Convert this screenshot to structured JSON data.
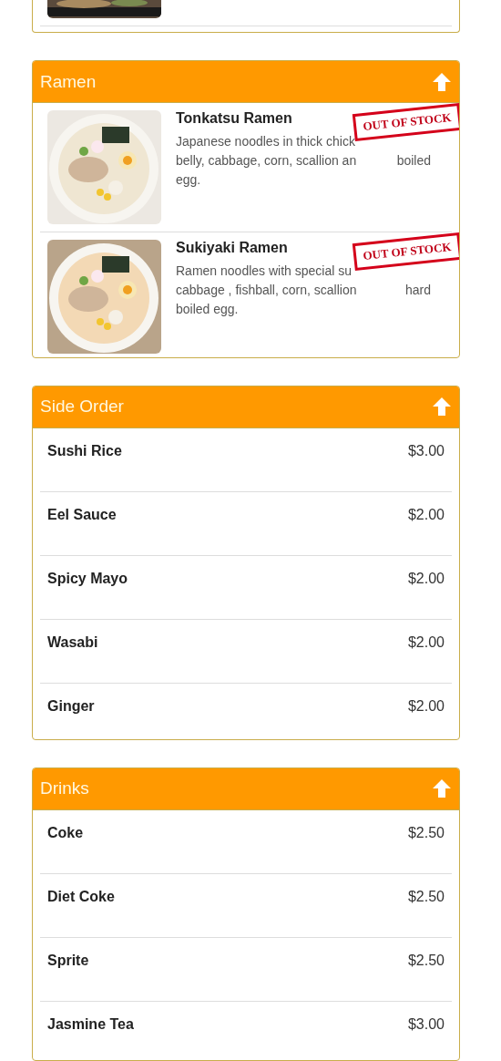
{
  "sections": [
    {
      "kind": "partial"
    },
    {
      "kind": "category",
      "title": "Ramen",
      "items": [
        {
          "kind": "dish",
          "name": "Tonkatsu Ramen",
          "description_lines": [
            {
              "left": "Japanese noodles in thick chick"
            },
            {
              "left": "belly, cabbage, corn, scallion an",
              "right": "boiled"
            },
            {
              "left": "egg."
            }
          ],
          "stamp": "OUT OF STOCK",
          "out_of_stock": true
        },
        {
          "kind": "dish",
          "name": "Sukiyaki Ramen",
          "description_lines": [
            {
              "left": "Ramen noodles with special su"
            },
            {
              "left": "cabbage , fishball, corn, scallion",
              "right": "hard"
            },
            {
              "left": "boiled egg."
            }
          ],
          "stamp": "OUT OF STOCK",
          "out_of_stock": true
        }
      ]
    },
    {
      "kind": "category",
      "title": "Side Order",
      "items": [
        {
          "kind": "simple",
          "name": "Sushi Rice",
          "price": "$3.00"
        },
        {
          "kind": "simple",
          "name": "Eel Sauce",
          "price": "$2.00"
        },
        {
          "kind": "simple",
          "name": "Spicy Mayo",
          "price": "$2.00"
        },
        {
          "kind": "simple",
          "name": "Wasabi",
          "price": "$2.00"
        },
        {
          "kind": "simple",
          "name": "Ginger",
          "price": "$2.00"
        }
      ]
    },
    {
      "kind": "category",
      "title": "Drinks",
      "items": [
        {
          "kind": "simple",
          "name": "Coke",
          "price": "$2.50"
        },
        {
          "kind": "simple",
          "name": "Diet Coke",
          "price": "$2.50"
        },
        {
          "kind": "simple",
          "name": "Sprite",
          "price": "$2.50"
        },
        {
          "kind": "simple",
          "name": "Jasmine Tea",
          "price": "$3.00"
        }
      ]
    }
  ]
}
